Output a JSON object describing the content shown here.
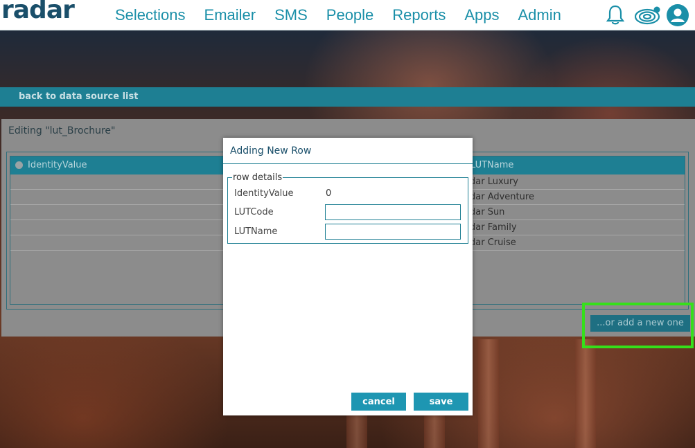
{
  "app": {
    "logo": "radar"
  },
  "nav": {
    "items": [
      {
        "label": "Selections"
      },
      {
        "label": "Emailer"
      },
      {
        "label": "SMS"
      },
      {
        "label": "People"
      },
      {
        "label": "Reports"
      },
      {
        "label": "Apps"
      },
      {
        "label": "Admin"
      }
    ],
    "icons": [
      "bell-icon",
      "radar-icon",
      "user-icon"
    ]
  },
  "backlink": {
    "label": "back to data source list"
  },
  "panel": {
    "title": "Editing \"lut_Brochure\"",
    "columns": [
      "IdentityValue",
      "LUTName"
    ],
    "rows": [
      {
        "lutname_visible": "dar Luxury"
      },
      {
        "lutname_visible": "dar Adventure"
      },
      {
        "lutname_visible": "dar Sun"
      },
      {
        "lutname_visible": "dar Family"
      },
      {
        "lutname_visible": "dar Cruise"
      }
    ],
    "add_new_label": "...or add a new one"
  },
  "modal": {
    "title": "Adding New Row",
    "fieldset_legend": "row details",
    "fields": {
      "identity_label": "IdentityValue",
      "identity_value": "0",
      "lutcode_label": "LUTCode",
      "lutcode_value": "",
      "lutname_label": "LUTName",
      "lutname_value": ""
    },
    "cancel_label": "cancel",
    "save_label": "save"
  },
  "colors": {
    "accent": "#1e96b2",
    "nav_text": "#1a8fa8",
    "brand": "#1a4f6a",
    "highlight": "#35e01a"
  }
}
